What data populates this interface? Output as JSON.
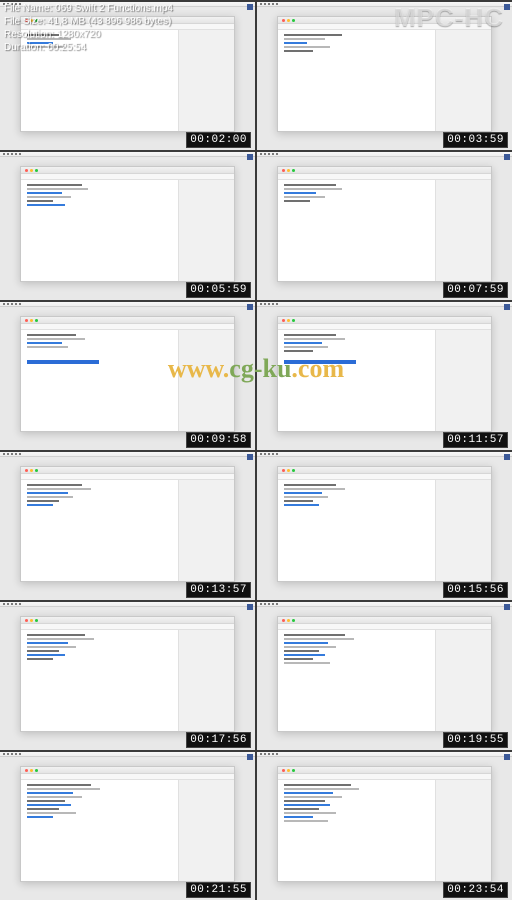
{
  "app_logo": "MPC-HC",
  "info": {
    "file_name_label": "File Name:",
    "file_name": "069 Swift 2 Functions.mp4",
    "file_size_label": "File Size:",
    "file_size": "41,8 MB (43 896 986 bytes)",
    "resolution_label": "Resolution:",
    "resolution": "1280x720",
    "duration_label": "Duration:",
    "duration": "00:25:54"
  },
  "watermark_host": "www.",
  "watermark_domain": "cg-ku",
  "watermark_tld": ".com",
  "thumbs": [
    {
      "ts": "00:02:00",
      "lines": [
        22,
        30,
        18,
        26
      ],
      "sel": false
    },
    {
      "ts": "00:03:59",
      "lines": [
        40,
        28,
        16,
        32,
        20
      ],
      "sel": false
    },
    {
      "ts": "00:05:59",
      "lines": [
        38,
        42,
        24,
        30,
        18,
        26
      ],
      "sel": false
    },
    {
      "ts": "00:07:59",
      "lines": [
        36,
        40,
        22,
        28,
        18
      ],
      "sel": false
    },
    {
      "ts": "00:09:58",
      "lines": [
        34,
        40,
        24,
        28
      ],
      "sel": true
    },
    {
      "ts": "00:11:57",
      "lines": [
        36,
        42,
        26,
        30,
        20
      ],
      "sel": true
    },
    {
      "ts": "00:13:57",
      "lines": [
        38,
        44,
        28,
        32,
        22,
        18
      ],
      "sel": false
    },
    {
      "ts": "00:15:56",
      "lines": [
        36,
        42,
        26,
        30,
        20,
        24
      ],
      "sel": false
    },
    {
      "ts": "00:17:56",
      "lines": [
        40,
        46,
        28,
        34,
        22,
        26,
        18
      ],
      "sel": false
    },
    {
      "ts": "00:19:55",
      "lines": [
        42,
        48,
        30,
        36,
        24,
        28,
        20,
        32
      ],
      "sel": false
    },
    {
      "ts": "00:21:55",
      "lines": [
        44,
        50,
        32,
        38,
        26,
        30,
        22,
        34,
        18
      ],
      "sel": false
    },
    {
      "ts": "00:23:54",
      "lines": [
        46,
        52,
        34,
        40,
        28,
        32,
        24,
        36,
        20,
        30
      ],
      "sel": false
    }
  ]
}
